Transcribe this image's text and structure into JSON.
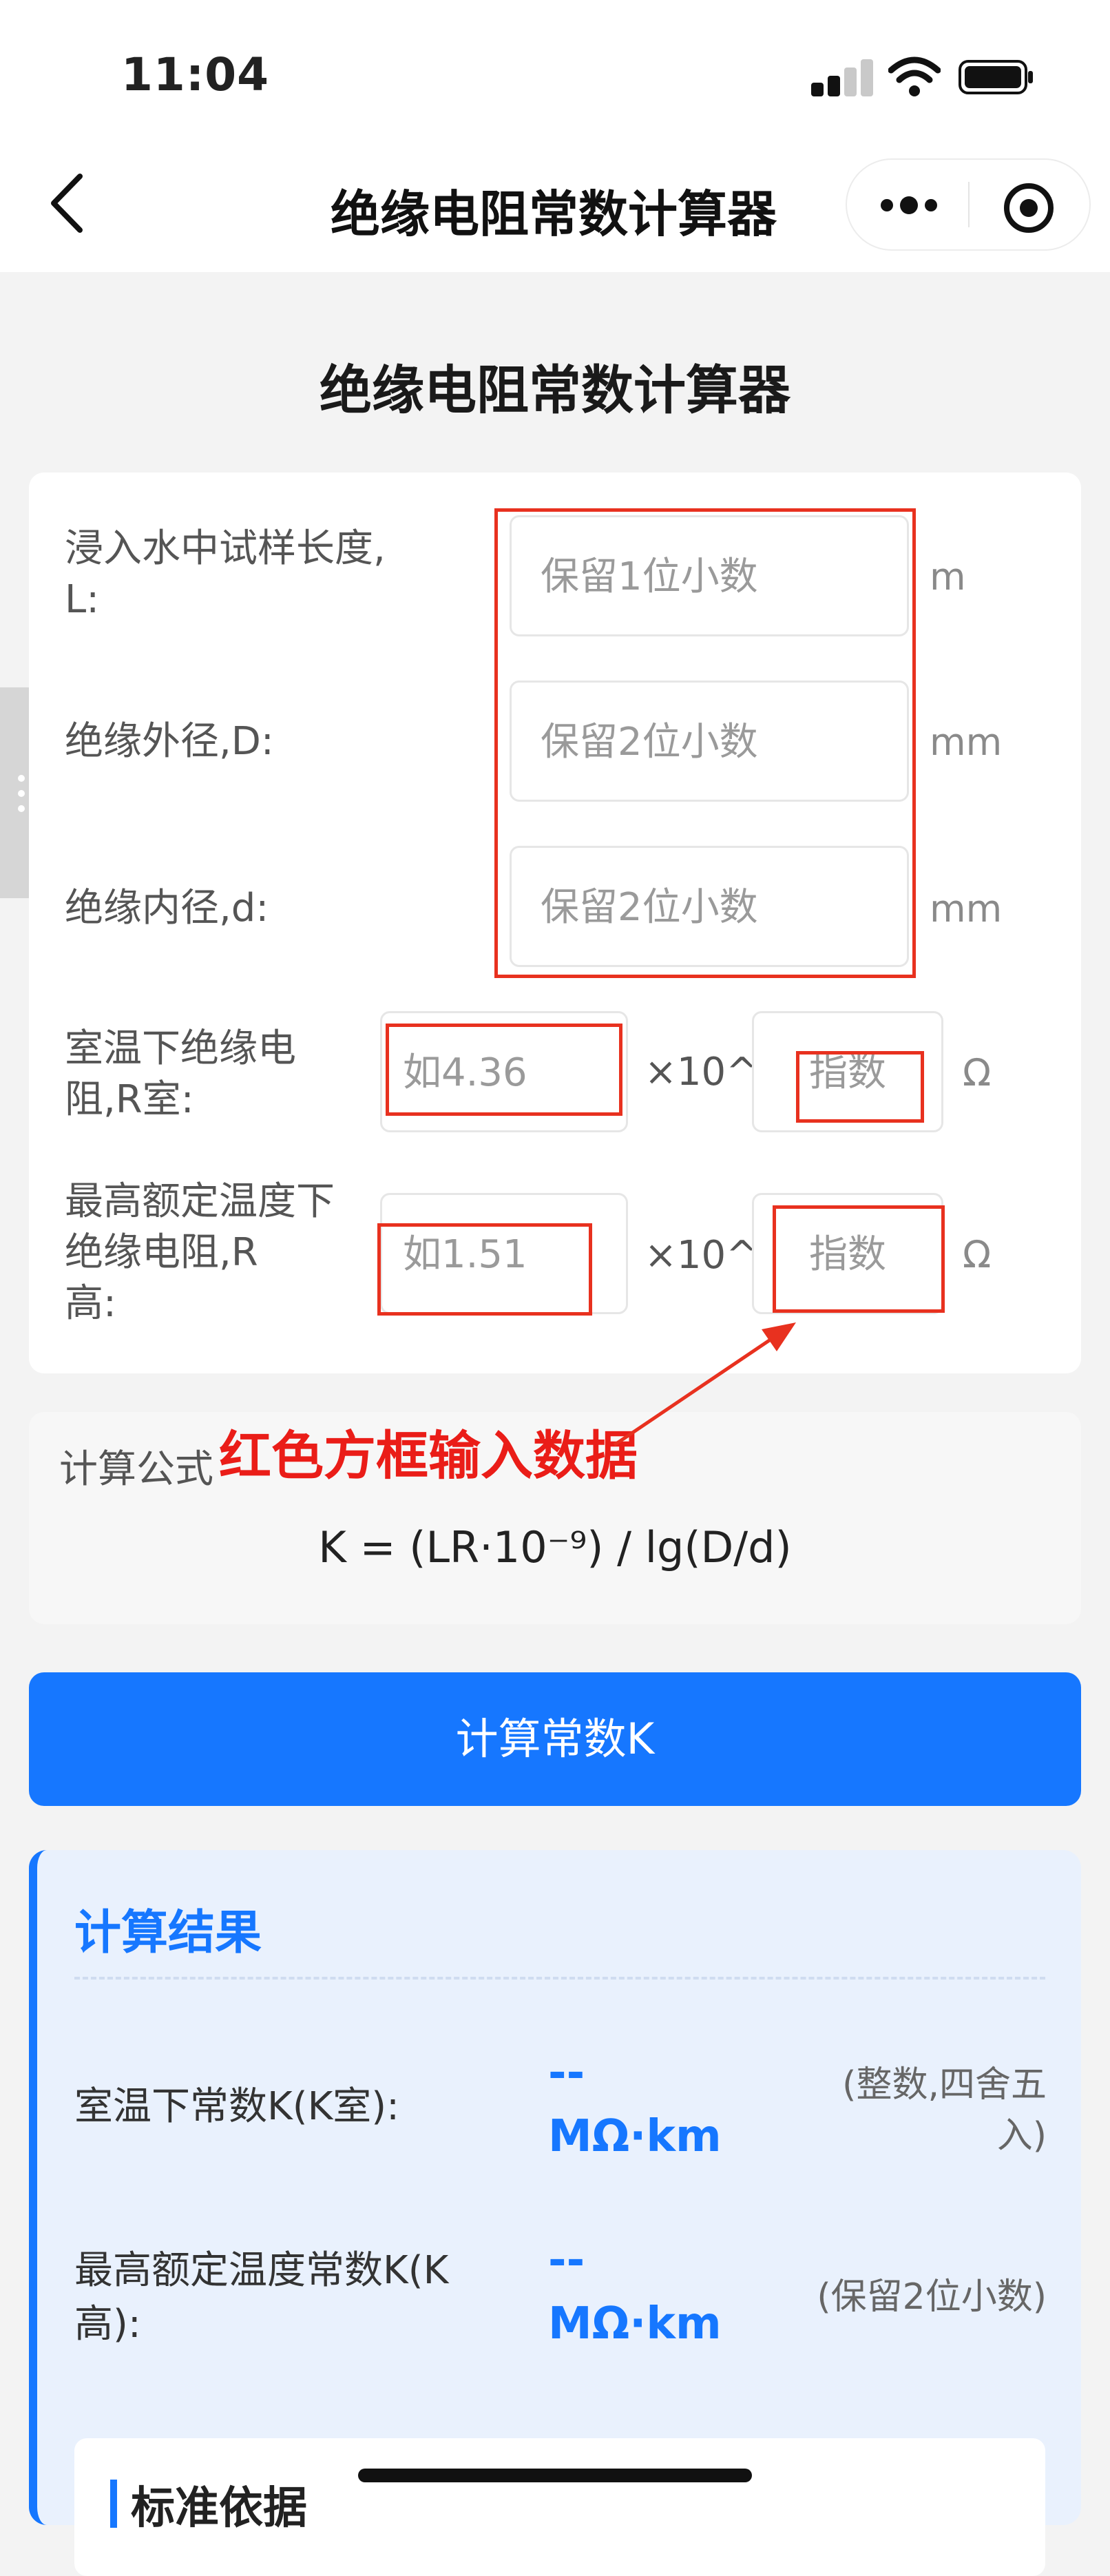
{
  "status_bar": {
    "time": "11:04"
  },
  "nav": {
    "title": "绝缘电阻常数计算器"
  },
  "page": {
    "title": "绝缘电阻常数计算器"
  },
  "form": {
    "length": {
      "label_line1": "浸入水中试样长度,",
      "label_line2": "L:",
      "placeholder": "保留1位小数",
      "unit": "m"
    },
    "outer_diameter": {
      "label": "绝缘外径,D:",
      "placeholder": "保留2位小数",
      "unit": "mm"
    },
    "inner_diameter": {
      "label": "绝缘内径,d:",
      "placeholder": "保留2位小数",
      "unit": "mm"
    },
    "r_room": {
      "label_line1": "室温下绝缘电",
      "label_line2": "阻,R室:",
      "mantissa_placeholder": "如4.36",
      "times": "×10^",
      "exponent_placeholder": "指数",
      "unit": "Ω"
    },
    "r_high": {
      "label_line1": "最高额定温度下",
      "label_line2": "绝缘电阻,R",
      "label_line3": "高:",
      "mantissa_placeholder": "如1.51",
      "times": "×10^",
      "exponent_placeholder": "指数",
      "unit": "Ω"
    }
  },
  "formula": {
    "label": "计算公式",
    "annotation": "红色方框输入数据",
    "expression": "K = (LR·10⁻⁹) / lg(D/d)"
  },
  "calc_button": {
    "label": "计算常数K"
  },
  "result": {
    "title": "计算结果",
    "k_room": {
      "label": "室温下常数K(K室):",
      "value": "--",
      "unit": "MΩ·km",
      "note_line1": "(整数,四舍五",
      "note_line2": "入)"
    },
    "k_high": {
      "label_line1": "最高额定温度常数K(K",
      "label_line2": "高):",
      "value": "--",
      "unit": "MΩ·km",
      "note": "(保留2位小数)"
    }
  },
  "standard": {
    "title": "标准依据"
  },
  "colors": {
    "accent": "#1677ff",
    "annotation_red": "#e8311f",
    "background": "#f3f3f3"
  }
}
